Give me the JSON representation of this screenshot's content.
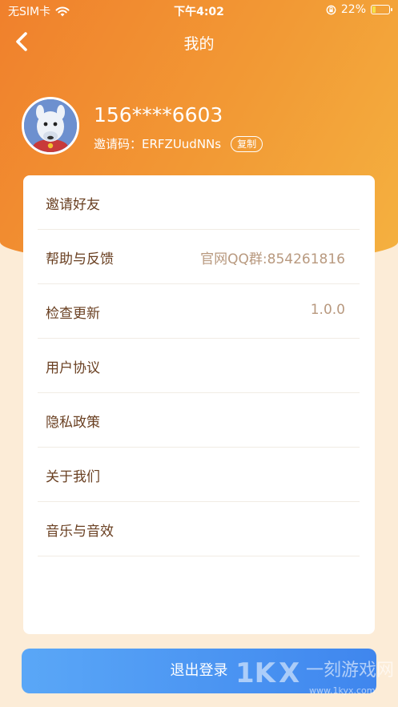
{
  "status_bar": {
    "carrier": "无SIM卡",
    "time": "下午4:02",
    "battery": "22%",
    "battery_level": 0.22
  },
  "nav": {
    "title": "我的"
  },
  "profile": {
    "phone": "156****6603",
    "invite_label": "邀请码：",
    "invite_code": "ERFZUudNNs",
    "copy_label": "复制"
  },
  "menu": {
    "items": [
      {
        "label": "邀请好友",
        "value": ""
      },
      {
        "label": "帮助与反馈",
        "value": "官网QQ群:854261816"
      },
      {
        "label": "检查更新",
        "value": "1.0.0"
      },
      {
        "label": "用户协议",
        "value": ""
      },
      {
        "label": "隐私政策",
        "value": ""
      },
      {
        "label": "关于我们",
        "value": ""
      },
      {
        "label": "音乐与音效",
        "value": ""
      }
    ]
  },
  "logout_label": "退出登录",
  "watermark": {
    "text": "一刻游戏网",
    "url": "www.1kyx.com"
  },
  "colors": {
    "header_start": "#f0802c",
    "header_end": "#f4b140",
    "page_bg": "#fcecd7",
    "label": "#6a4022",
    "value": "#b8997f",
    "button": "#4a96f2"
  }
}
